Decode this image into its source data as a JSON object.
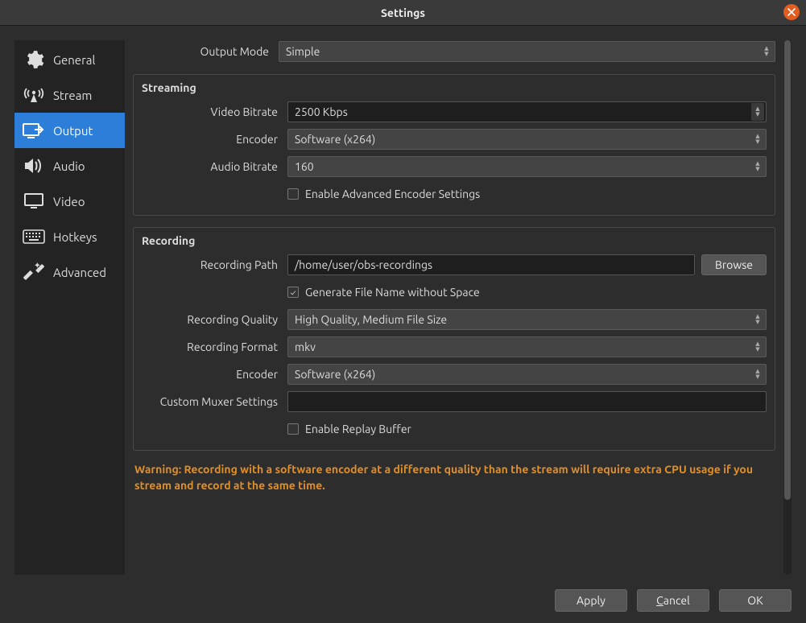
{
  "window": {
    "title": "Settings"
  },
  "sidebar": {
    "items": [
      {
        "label": "General"
      },
      {
        "label": "Stream"
      },
      {
        "label": "Output"
      },
      {
        "label": "Audio"
      },
      {
        "label": "Video"
      },
      {
        "label": "Hotkeys"
      },
      {
        "label": "Advanced"
      }
    ]
  },
  "output_mode": {
    "label": "Output Mode",
    "value": "Simple"
  },
  "streaming": {
    "title": "Streaming",
    "video_bitrate": {
      "label": "Video Bitrate",
      "value": "2500 Kbps"
    },
    "encoder": {
      "label": "Encoder",
      "value": "Software (x264)"
    },
    "audio_bitrate": {
      "label": "Audio Bitrate",
      "value": "160"
    },
    "advanced_encoder": {
      "label": "Enable Advanced Encoder Settings",
      "checked": false
    }
  },
  "recording": {
    "title": "Recording",
    "path": {
      "label": "Recording Path",
      "value": "/home/user/obs-recordings",
      "browse": "Browse"
    },
    "gen_no_space": {
      "label": "Generate File Name without Space",
      "checked": true
    },
    "quality": {
      "label": "Recording Quality",
      "value": "High Quality, Medium File Size"
    },
    "format": {
      "label": "Recording Format",
      "value": "mkv"
    },
    "encoder": {
      "label": "Encoder",
      "value": "Software (x264)"
    },
    "muxer": {
      "label": "Custom Muxer Settings",
      "value": ""
    },
    "replay_buffer": {
      "label": "Enable Replay Buffer",
      "checked": false
    }
  },
  "warning": "Warning: Recording with a software encoder at a different quality than the stream will require extra CPU usage if you stream and record at the same time.",
  "footer": {
    "apply": "Apply",
    "cancel": "Cancel",
    "ok": "OK"
  }
}
